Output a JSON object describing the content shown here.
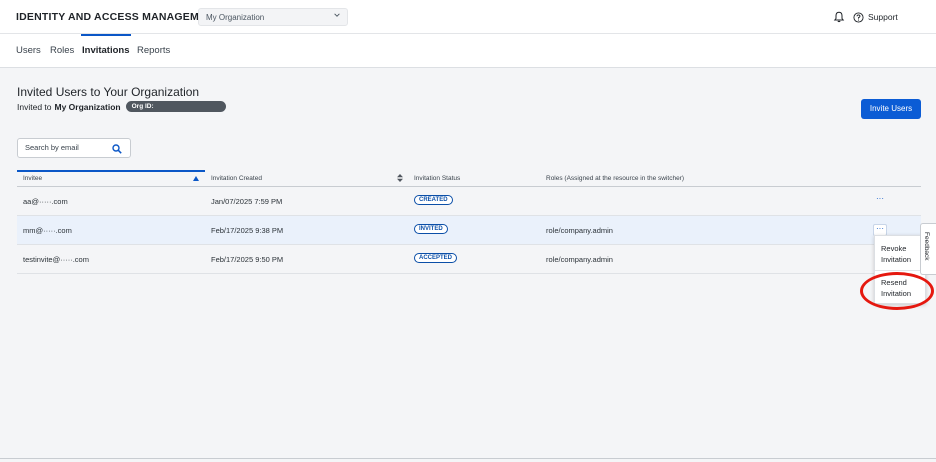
{
  "app": {
    "title": "IDENTITY AND ACCESS MANAGEMENT",
    "org_selected": "My Organization",
    "support_label": "Support"
  },
  "tabs": [
    {
      "label": "Users"
    },
    {
      "label": "Roles"
    },
    {
      "label": "Invitations",
      "active": true
    },
    {
      "label": "Reports"
    }
  ],
  "page": {
    "heading": "Invited Users to Your Organization",
    "sub_prefix": "Invited to",
    "sub_org": "My Organization",
    "org_id_label": "Org ID:",
    "invite_button": "Invite Users",
    "search_placeholder": "Search by email"
  },
  "table": {
    "columns": [
      "Invitee",
      "Invitation Created",
      "Invitation Status",
      "Roles (Assigned at the resource in the switcher)"
    ],
    "sort_column": "Invitee",
    "sort_direction": "ascending",
    "rows": [
      {
        "invitee": "aa@·····.com",
        "created": "Jan/07/2025 7:59 PM",
        "status": "CREATED",
        "roles": ""
      },
      {
        "invitee": "mm@·····.com",
        "created": "Feb/17/2025 9:38 PM",
        "status": "INVITED",
        "roles": "role/company.admin"
      },
      {
        "invitee": "testinvite@·····.com",
        "created": "Feb/17/2025 9:50 PM",
        "status": "ACCEPTED",
        "roles": "role/company.admin"
      }
    ],
    "more_label": "···"
  },
  "row_menu": {
    "revoke": "Revoke Invitation",
    "resend": "Resend Invitation"
  },
  "feedback_label": "Feedback",
  "colors": {
    "accent": "#0b5cd5",
    "highlight": "#e5180f",
    "status": "#0b4fa8"
  },
  "icons": [
    "chevron-down-icon",
    "bell-icon",
    "help-circle-icon",
    "search-icon",
    "sort-ascending-icon",
    "sort-icon",
    "more-icon"
  ]
}
